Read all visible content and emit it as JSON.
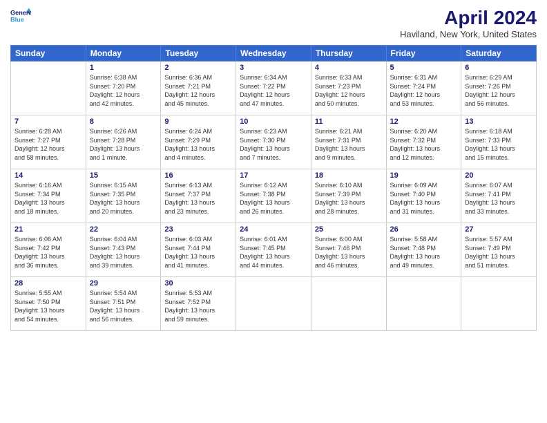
{
  "logo": {
    "line1": "General",
    "line2": "Blue"
  },
  "title": "April 2024",
  "subtitle": "Haviland, New York, United States",
  "days_of_week": [
    "Sunday",
    "Monday",
    "Tuesday",
    "Wednesday",
    "Thursday",
    "Friday",
    "Saturday"
  ],
  "weeks": [
    [
      {
        "day": "",
        "info": ""
      },
      {
        "day": "1",
        "info": "Sunrise: 6:38 AM\nSunset: 7:20 PM\nDaylight: 12 hours\nand 42 minutes."
      },
      {
        "day": "2",
        "info": "Sunrise: 6:36 AM\nSunset: 7:21 PM\nDaylight: 12 hours\nand 45 minutes."
      },
      {
        "day": "3",
        "info": "Sunrise: 6:34 AM\nSunset: 7:22 PM\nDaylight: 12 hours\nand 47 minutes."
      },
      {
        "day": "4",
        "info": "Sunrise: 6:33 AM\nSunset: 7:23 PM\nDaylight: 12 hours\nand 50 minutes."
      },
      {
        "day": "5",
        "info": "Sunrise: 6:31 AM\nSunset: 7:24 PM\nDaylight: 12 hours\nand 53 minutes."
      },
      {
        "day": "6",
        "info": "Sunrise: 6:29 AM\nSunset: 7:26 PM\nDaylight: 12 hours\nand 56 minutes."
      }
    ],
    [
      {
        "day": "7",
        "info": "Sunrise: 6:28 AM\nSunset: 7:27 PM\nDaylight: 12 hours\nand 58 minutes."
      },
      {
        "day": "8",
        "info": "Sunrise: 6:26 AM\nSunset: 7:28 PM\nDaylight: 13 hours\nand 1 minute."
      },
      {
        "day": "9",
        "info": "Sunrise: 6:24 AM\nSunset: 7:29 PM\nDaylight: 13 hours\nand 4 minutes."
      },
      {
        "day": "10",
        "info": "Sunrise: 6:23 AM\nSunset: 7:30 PM\nDaylight: 13 hours\nand 7 minutes."
      },
      {
        "day": "11",
        "info": "Sunrise: 6:21 AM\nSunset: 7:31 PM\nDaylight: 13 hours\nand 9 minutes."
      },
      {
        "day": "12",
        "info": "Sunrise: 6:20 AM\nSunset: 7:32 PM\nDaylight: 13 hours\nand 12 minutes."
      },
      {
        "day": "13",
        "info": "Sunrise: 6:18 AM\nSunset: 7:33 PM\nDaylight: 13 hours\nand 15 minutes."
      }
    ],
    [
      {
        "day": "14",
        "info": "Sunrise: 6:16 AM\nSunset: 7:34 PM\nDaylight: 13 hours\nand 18 minutes."
      },
      {
        "day": "15",
        "info": "Sunrise: 6:15 AM\nSunset: 7:35 PM\nDaylight: 13 hours\nand 20 minutes."
      },
      {
        "day": "16",
        "info": "Sunrise: 6:13 AM\nSunset: 7:37 PM\nDaylight: 13 hours\nand 23 minutes."
      },
      {
        "day": "17",
        "info": "Sunrise: 6:12 AM\nSunset: 7:38 PM\nDaylight: 13 hours\nand 26 minutes."
      },
      {
        "day": "18",
        "info": "Sunrise: 6:10 AM\nSunset: 7:39 PM\nDaylight: 13 hours\nand 28 minutes."
      },
      {
        "day": "19",
        "info": "Sunrise: 6:09 AM\nSunset: 7:40 PM\nDaylight: 13 hours\nand 31 minutes."
      },
      {
        "day": "20",
        "info": "Sunrise: 6:07 AM\nSunset: 7:41 PM\nDaylight: 13 hours\nand 33 minutes."
      }
    ],
    [
      {
        "day": "21",
        "info": "Sunrise: 6:06 AM\nSunset: 7:42 PM\nDaylight: 13 hours\nand 36 minutes."
      },
      {
        "day": "22",
        "info": "Sunrise: 6:04 AM\nSunset: 7:43 PM\nDaylight: 13 hours\nand 39 minutes."
      },
      {
        "day": "23",
        "info": "Sunrise: 6:03 AM\nSunset: 7:44 PM\nDaylight: 13 hours\nand 41 minutes."
      },
      {
        "day": "24",
        "info": "Sunrise: 6:01 AM\nSunset: 7:45 PM\nDaylight: 13 hours\nand 44 minutes."
      },
      {
        "day": "25",
        "info": "Sunrise: 6:00 AM\nSunset: 7:46 PM\nDaylight: 13 hours\nand 46 minutes."
      },
      {
        "day": "26",
        "info": "Sunrise: 5:58 AM\nSunset: 7:48 PM\nDaylight: 13 hours\nand 49 minutes."
      },
      {
        "day": "27",
        "info": "Sunrise: 5:57 AM\nSunset: 7:49 PM\nDaylight: 13 hours\nand 51 minutes."
      }
    ],
    [
      {
        "day": "28",
        "info": "Sunrise: 5:55 AM\nSunset: 7:50 PM\nDaylight: 13 hours\nand 54 minutes."
      },
      {
        "day": "29",
        "info": "Sunrise: 5:54 AM\nSunset: 7:51 PM\nDaylight: 13 hours\nand 56 minutes."
      },
      {
        "day": "30",
        "info": "Sunrise: 5:53 AM\nSunset: 7:52 PM\nDaylight: 13 hours\nand 59 minutes."
      },
      {
        "day": "",
        "info": ""
      },
      {
        "day": "",
        "info": ""
      },
      {
        "day": "",
        "info": ""
      },
      {
        "day": "",
        "info": ""
      }
    ]
  ]
}
